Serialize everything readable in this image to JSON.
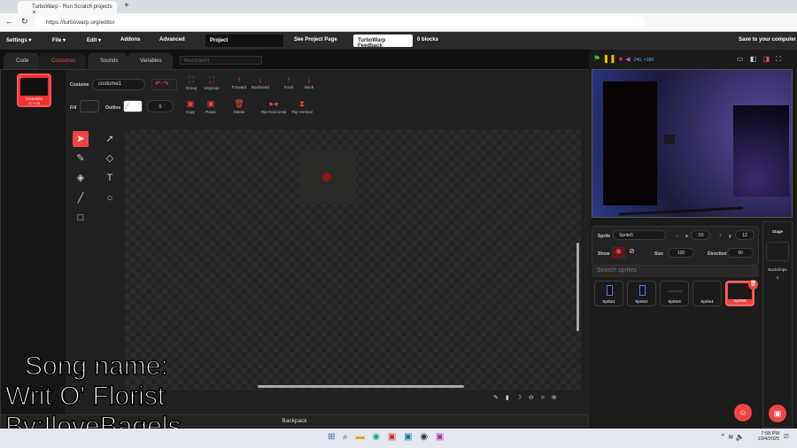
{
  "browser": {
    "tab_title": "TurboWarp - Run Scratch projects",
    "url": "https://turbowarp.org/editor"
  },
  "menu": {
    "settings": "Settings ▾",
    "file": "File ▾",
    "edit": "Edit ▾",
    "addons": "Addons",
    "advanced": "Advanced",
    "project_title": "Project",
    "see_project_page": "See Project Page",
    "feedback": "TurboWarp Feedback",
    "blocks": "0 blocks",
    "save": "Save to your computer"
  },
  "tabs": {
    "code": "Code",
    "costumes": "Costumes",
    "sounds": "Sounds",
    "variables": "Variables",
    "find_placeholder": "Find (Ctrl+F)"
  },
  "costume_list": [
    {
      "index": "1",
      "name": "costume1",
      "size": "27 x 25"
    }
  ],
  "paint": {
    "costume_label": "Costume",
    "costume_name": "costume1",
    "group": "Group",
    "ungroup": "Ungroup",
    "forward": "Forward",
    "backward": "Backward",
    "front": "Front",
    "back": "Back",
    "fill": "Fill",
    "outline": "Outline",
    "outline_width": "0",
    "copy": "Copy",
    "paste": "Paste",
    "delete": "Delete",
    "flip_h": "Flip Horizontal",
    "flip_v": "Flip Vertical"
  },
  "stage_header": {
    "coords": "-240, +180"
  },
  "sprite_info": {
    "sprite_label": "Sprite",
    "sprite_name": "Sprite5",
    "x_label": "x",
    "x": "-55",
    "y_label": "y",
    "y": "12",
    "show_label": "Show",
    "size_label": "Size",
    "size": "100",
    "direction_label": "Direction",
    "direction": "90"
  },
  "search_placeholder": "Search sprites",
  "sprites": [
    "Sprite1",
    "Sprite2",
    "Sprite3",
    "Sprite4",
    "Sprite5"
  ],
  "stage_pane": {
    "title": "Stage",
    "backdrops_label": "Backdrops",
    "backdrops_count": "1"
  },
  "backpack": "Backpack",
  "overlay": {
    "line1": "Song name:",
    "line2": "Writ O' Florist",
    "line3": "By:IloveBagels"
  },
  "taskbar": {
    "time": "7:58 PM",
    "date": "10/4/2025"
  },
  "colors": {
    "accent": "#f04545",
    "menubar": "#2a2a2a"
  }
}
